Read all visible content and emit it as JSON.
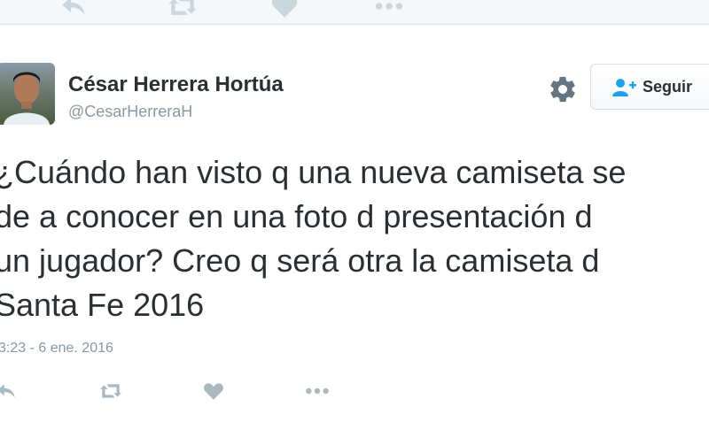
{
  "tweet": {
    "author_name": "César Herrera Hortúa",
    "author_handle": "@CesarHerreraH",
    "text_lines": [
      "¿Cuándo han visto q una nueva camiseta se",
      "de a conocer en una foto d presentación d",
      "un jugador? Creo q será otra la camiseta d",
      "Santa Fe 2016"
    ],
    "timestamp": "3:23 - 6 ene. 2016"
  },
  "follow_button": {
    "label": "Seguir"
  },
  "icons": [
    "reply-icon",
    "retweet-icon",
    "like-icon",
    "more-icon",
    "gear-icon",
    "follow-person-icon"
  ],
  "colors": {
    "text": "#292f33",
    "muted": "#8899a6",
    "icon": "#aab8c2",
    "accent": "#1da1f2",
    "background": "#f5f8fa"
  }
}
